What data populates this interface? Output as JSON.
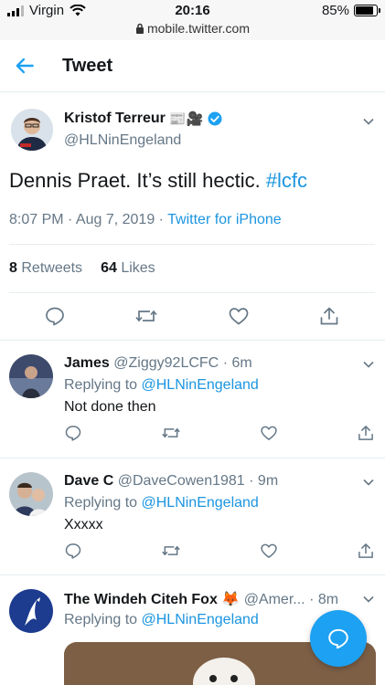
{
  "status_bar": {
    "carrier": "Virgin",
    "time": "20:16",
    "url": "mobile.twitter.com",
    "battery": "85%",
    "battery_level": 0.85
  },
  "header": {
    "title": "Tweet"
  },
  "tweet": {
    "author_name": "Kristof Terreur",
    "author_emoji": "📰🎥",
    "handle": "@HLNinEngeland",
    "text": "Dennis Praet. It’s still hectic. ",
    "hashtag": "#lcfc",
    "datetime": "8:07 PM · Aug 7, 2019 · ",
    "source": "Twitter for iPhone",
    "retweets_count": "8",
    "retweets_label": "Retweets",
    "likes_count": "64",
    "likes_label": "Likes"
  },
  "replies": [
    {
      "name": "James",
      "handle": "@Ziggy92LCFC",
      "time": "· 6m",
      "replying_prefix": "Replying to ",
      "replying_to": "@HLNinEngeland",
      "text": "Not done then"
    },
    {
      "name": "Dave C",
      "handle": "@DaveCowen1981",
      "time": "· 9m",
      "replying_prefix": "Replying to ",
      "replying_to": "@HLNinEngeland",
      "text": "Xxxxx"
    },
    {
      "name": "The Windeh Citeh Fox",
      "emoji": "🦊",
      "handle": "@Amer...",
      "time": "· 8m",
      "replying_prefix": "Replying to ",
      "replying_to": "@HLNinEngeland",
      "text": ""
    }
  ],
  "icons": [
    "back-arrow-icon",
    "chevron-down-icon",
    "verified-icon",
    "reply-icon",
    "retweet-icon",
    "like-icon",
    "share-icon",
    "compose-icon",
    "lock-icon",
    "wifi-icon"
  ],
  "colors": {
    "accent": "#1da1f2",
    "link": "#1b95e0",
    "secondary_text": "#657786",
    "divider": "#e6ecf0"
  }
}
